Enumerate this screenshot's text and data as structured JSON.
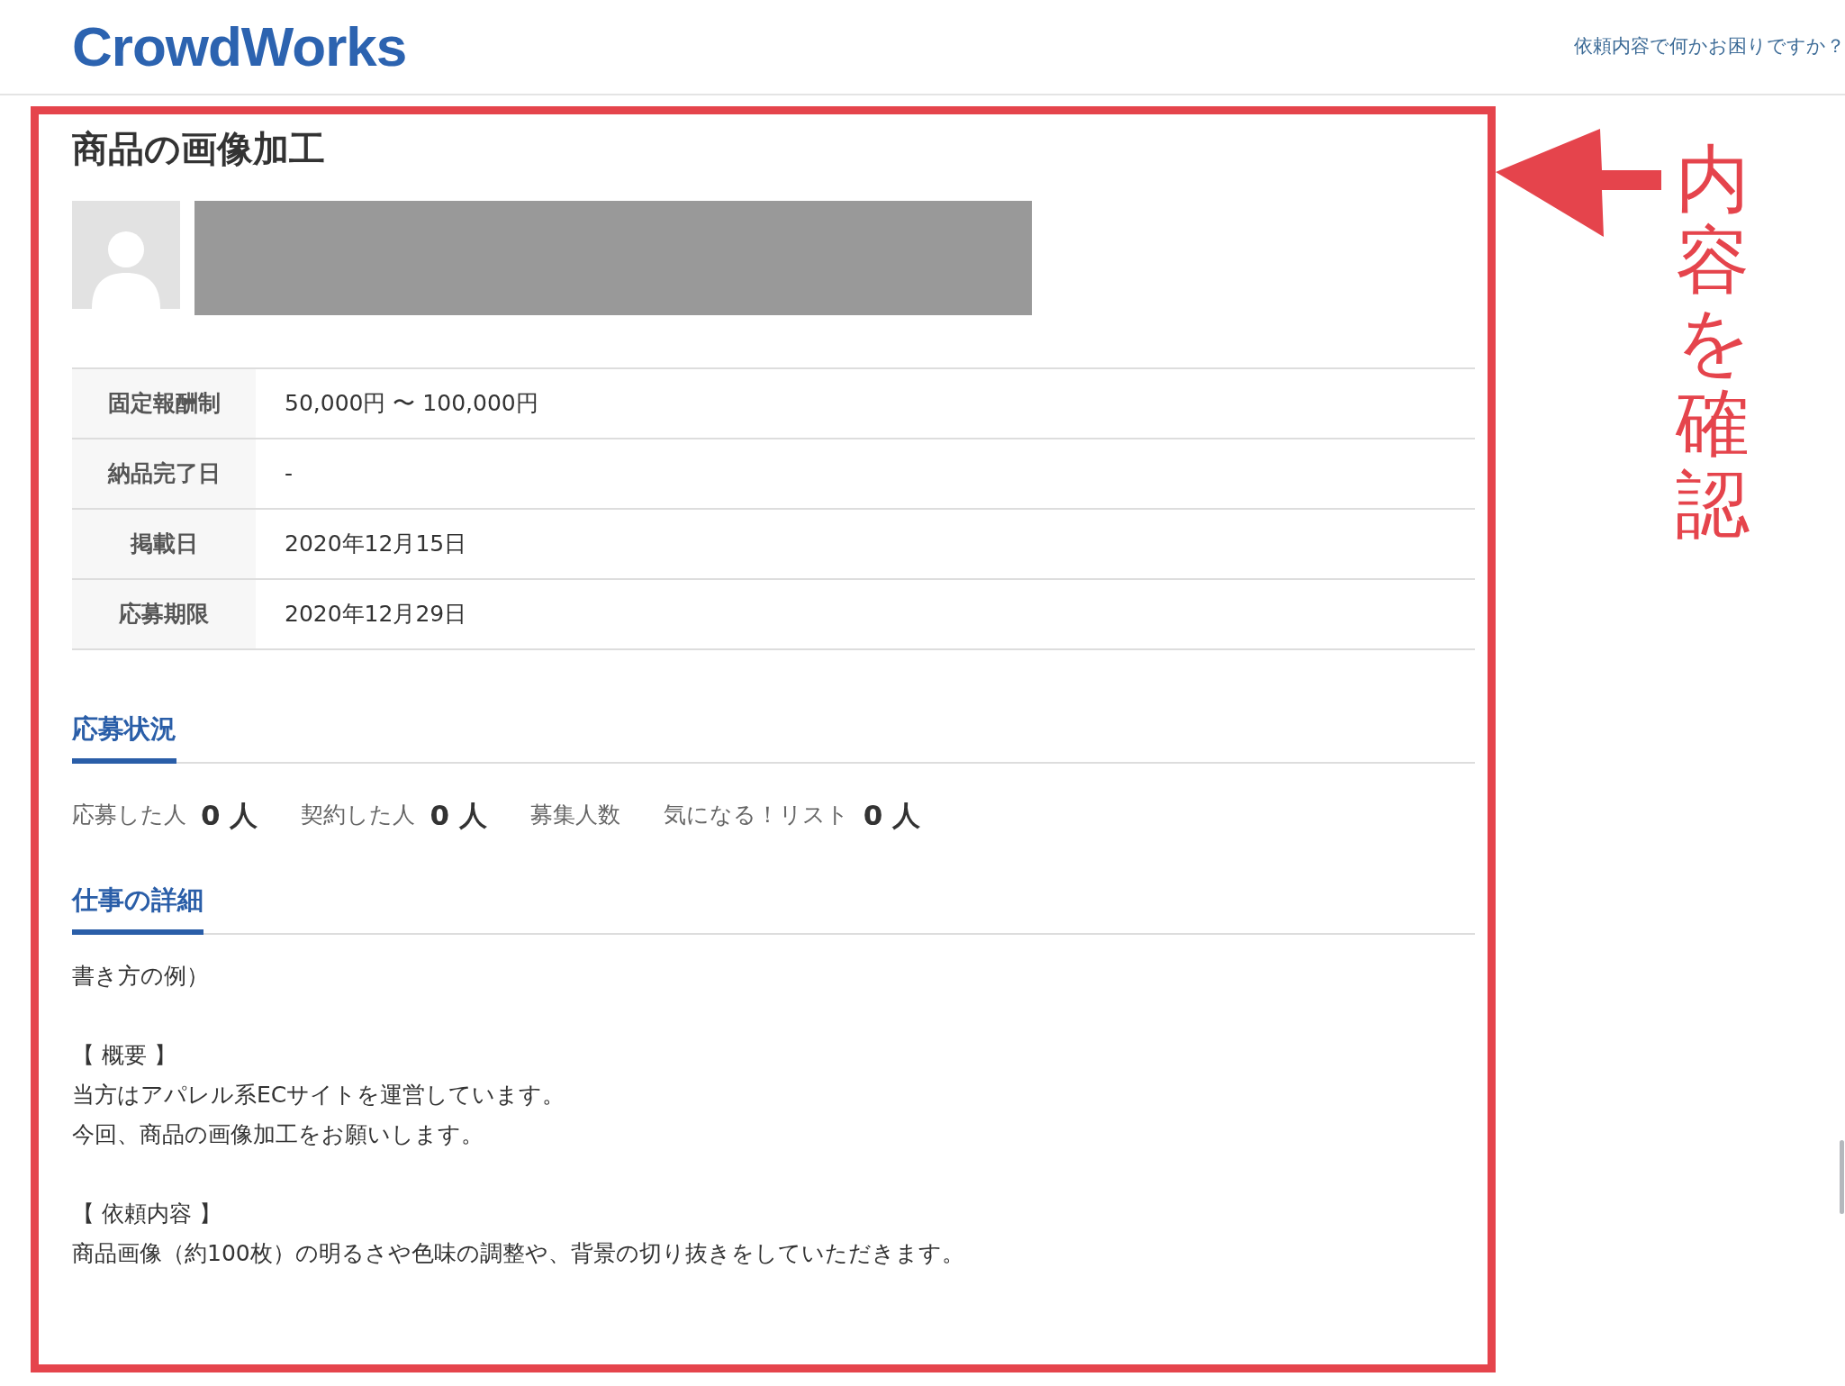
{
  "header": {
    "logo": "CrowdWorks",
    "help_link": "依頼内容で何かお困りですか？"
  },
  "job": {
    "title": "商品の画像加工",
    "details": [
      {
        "label": "固定報酬制",
        "value": "50,000円 〜 100,000円"
      },
      {
        "label": "納品完了日",
        "value": "-"
      },
      {
        "label": "掲載日",
        "value": "2020年12月15日"
      },
      {
        "label": "応募期限",
        "value": "2020年12月29日"
      }
    ],
    "status_section": {
      "heading": "応募状況",
      "stats": [
        {
          "label": "応募した人",
          "count": "0 人"
        },
        {
          "label": "契約した人",
          "count": "0 人"
        },
        {
          "label": "募集人数"
        },
        {
          "label": "気になる！リスト",
          "count": "0 人"
        }
      ]
    },
    "detail_section": {
      "heading": "仕事の詳細",
      "paragraphs": [
        [
          "書き方の例）"
        ],
        [
          "【 概要 】",
          "当方はアパレル系ECサイトを運営しています。",
          "今回、商品の画像加工をお願いします。"
        ],
        [
          "【 依頼内容 】",
          "商品画像（約100枚）の明るさや色味の調整や、背景の切り抜きをしていただきます。"
        ]
      ]
    }
  },
  "annotation": {
    "text": "内容を確認"
  }
}
